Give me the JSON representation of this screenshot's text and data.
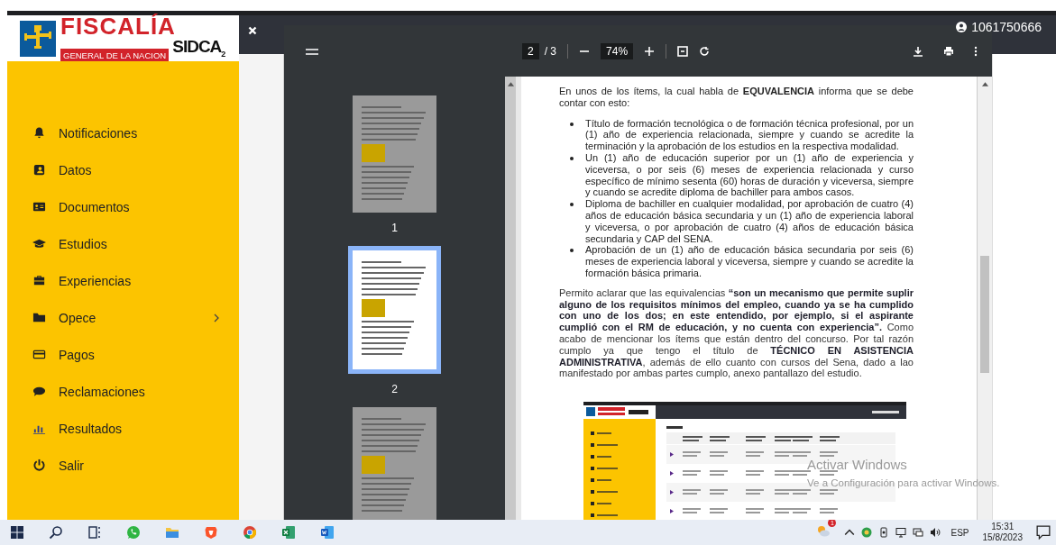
{
  "logo": {
    "title": "FISCALÍA",
    "subtitle": "GENERAL DE LA NACION",
    "product": "SIDCA",
    "product_suffix": "2"
  },
  "header": {
    "user": "1061750666"
  },
  "sidebar": {
    "items": [
      {
        "label": "Notificaciones",
        "expandable": false
      },
      {
        "label": "Datos",
        "expandable": false
      },
      {
        "label": "Documentos",
        "expandable": false
      },
      {
        "label": "Estudios",
        "expandable": false
      },
      {
        "label": "Experiencias",
        "expandable": false
      },
      {
        "label": "Opece",
        "expandable": true
      },
      {
        "label": "Pagos",
        "expandable": false
      },
      {
        "label": "Reclamaciones",
        "expandable": false
      },
      {
        "label": "Resultados",
        "expandable": false
      },
      {
        "label": "Salir",
        "expandable": false
      }
    ]
  },
  "pdf_toolbar": {
    "page": "2",
    "page_count": "/ 3",
    "zoom": "74%"
  },
  "thumbnails": [
    {
      "label": "1",
      "selected": false
    },
    {
      "label": "2",
      "selected": true
    },
    {
      "selected": false
    }
  ],
  "document": {
    "intro": "En unos de los ítems, la cual habla de **EQUVALENCIA** informa que se debe contar con esto:",
    "bullets": [
      "Título de formación tecnológica o de formación técnica profesional, por un (1) año de experiencia relacionada, siempre y cuando se acredite la terminación y la aprobación de los estudios en la respectiva modalidad.",
      "Un (1) año de educación superior por un (1) año de experiencia y viceversa, o por seis (6) meses de experiencia relacionada y curso específico de mínimo sesenta (60) horas de duración y viceversa, siempre y cuando se acredite diploma de bachiller para ambos casos.",
      "Diploma de bachiller en cualquier modalidad, por aprobación de cuatro (4) años de educación básica secundaria y un (1) año de experiencia laboral y viceversa, o por aprobación de cuatro (4) años de educación básica secundaria y CAP del SENA.",
      "Aprobación de un (1) año de educación básica secundaria por seis (6) meses de experiencia laboral y viceversa, siempre y cuando se acredite la formación básica primaria."
    ],
    "paragraph": "Permito aclarar que las equivalencias **“son un mecanismo que permite suplir alguno de los requisitos mínimos del empleo, cuando ya se ha cumplido con uno de los dos; en este entendido, por ejemplo, si el aspirante cumplió con el RM de educación, y no cuenta con experiencia”.** Como acabo de mencionar los ítems que están dentro del concurso. Por tal razón cumplo ya que tengo el título de **TÉCNICO EN ASISTENCIA ADMINISTRATIVA**, además de ello cuanto con cursos del Sena, dado a lao manifestado por ambas partes cumplo, anexo pantallazo del estudio."
  },
  "activation_notice": {
    "title": "Activar Windows",
    "text": "Ve a Configuración para activar Windows."
  },
  "taskbar": {
    "notification_badge": "1",
    "language": "ESP",
    "time": "15:31",
    "date": "15/8/2023"
  }
}
